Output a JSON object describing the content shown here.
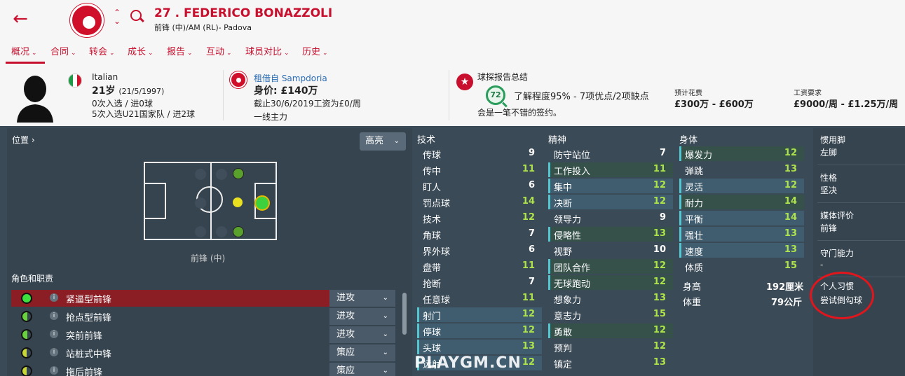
{
  "header": {
    "title": "27 . FEDERICO BONAZZOLI",
    "subtitle": "前锋 (中)/AM (RL)- Padova"
  },
  "tabs": [
    {
      "label": "概况"
    },
    {
      "label": "合同"
    },
    {
      "label": "转会"
    },
    {
      "label": "成长"
    },
    {
      "label": "报告"
    },
    {
      "label": "互动"
    },
    {
      "label": "球员对比"
    },
    {
      "label": "历史"
    }
  ],
  "info": {
    "nationality": "Italian",
    "age": "21岁",
    "dob": "(21/5/1997)",
    "caps": "0次入选 / 进0球",
    "u21": "5次入选U21国家队 / 进2球",
    "loan_from": "租借自 Sampdoria",
    "value": "身价: £140万",
    "contract": "截止30/6/2019工资为£0/周",
    "squad_status": "一线主力",
    "scout_title": "球探报告总结",
    "scout_rating": "72",
    "knowledge": "了解程度95% - 7项优点/2项缺点",
    "verdict": "会是一笔不错的签约。",
    "est_fee_label": "预计花费",
    "est_fee": "£300万 - £600万",
    "wage_label": "工资要求",
    "wage": "£9000/周 - £1.25万/周"
  },
  "position_panel": {
    "title": "位置",
    "highlight_label": "高亮",
    "position_label": "前锋 (中)",
    "roles_title": "角色和职责",
    "roles": [
      {
        "name": "紧逼型前锋",
        "duty": "进攻"
      },
      {
        "name": "抢点型前锋",
        "duty": "进攻"
      },
      {
        "name": "突前前锋",
        "duty": "进攻"
      },
      {
        "name": "站桩式中锋",
        "duty": "策应"
      },
      {
        "name": "拖后前锋",
        "duty": "策应"
      }
    ]
  },
  "attributes": {
    "technical_title": "技术",
    "technical": [
      {
        "name": "传球",
        "value": "9"
      },
      {
        "name": "传中",
        "value": "11"
      },
      {
        "name": "盯人",
        "value": "6"
      },
      {
        "name": "罚点球",
        "value": "14"
      },
      {
        "name": "技术",
        "value": "12"
      },
      {
        "name": "角球",
        "value": "7"
      },
      {
        "name": "界外球",
        "value": "6"
      },
      {
        "name": "盘带",
        "value": "11"
      },
      {
        "name": "抢断",
        "value": "7"
      },
      {
        "name": "任意球",
        "value": "11"
      },
      {
        "name": "射门",
        "value": "12"
      },
      {
        "name": "停球",
        "value": "12"
      },
      {
        "name": "头球",
        "value": "13"
      },
      {
        "name": "远射",
        "value": "12"
      }
    ],
    "mental_title": "精神",
    "mental": [
      {
        "name": "防守站位",
        "value": "7"
      },
      {
        "name": "工作投入",
        "value": "11"
      },
      {
        "name": "集中",
        "value": "12"
      },
      {
        "name": "决断",
        "value": "12"
      },
      {
        "name": "领导力",
        "value": "9"
      },
      {
        "name": "侵略性",
        "value": "13"
      },
      {
        "name": "视野",
        "value": "10"
      },
      {
        "name": "团队合作",
        "value": "12"
      },
      {
        "name": "无球跑动",
        "value": "12"
      },
      {
        "name": "想象力",
        "value": "13"
      },
      {
        "name": "意志力",
        "value": "15"
      },
      {
        "name": "勇敢",
        "value": "12"
      },
      {
        "name": "预判",
        "value": "12"
      },
      {
        "name": "镇定",
        "value": "13"
      }
    ],
    "physical_title": "身体",
    "physical": [
      {
        "name": "爆发力",
        "value": "12"
      },
      {
        "name": "弹跳",
        "value": "13"
      },
      {
        "name": "灵活",
        "value": "12"
      },
      {
        "name": "耐力",
        "value": "14"
      },
      {
        "name": "平衡",
        "value": "14"
      },
      {
        "name": "强壮",
        "value": "13"
      },
      {
        "name": "速度",
        "value": "13"
      },
      {
        "name": "体质",
        "value": "15"
      }
    ],
    "height_label": "身高",
    "height": "192厘米",
    "weight_label": "体重",
    "weight": "79公斤"
  },
  "side": {
    "foot_label": "惯用脚",
    "foot": "左脚",
    "personality_label": "性格",
    "personality": "坚决",
    "media_label": "媒体评价",
    "media": "前锋",
    "gk_label": "守门能力",
    "gk": "-",
    "ppm_label": "个人习惯",
    "ppm": "尝试倒勾球"
  },
  "watermark": "PLAYGM.CN",
  "colors": {
    "accent": "#c8102e",
    "panel": "#36444f",
    "good": "#aee34a"
  }
}
